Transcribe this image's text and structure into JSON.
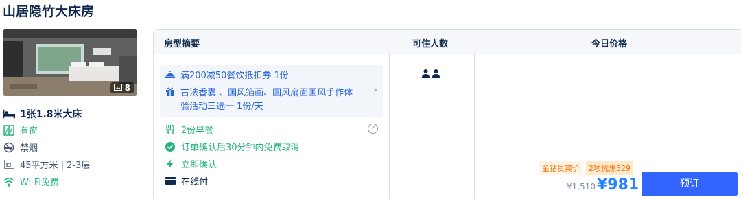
{
  "room": {
    "title": "山居隐竹大床房",
    "photo_count": "8"
  },
  "details": {
    "bed": "1张1.8米大床",
    "window": "有窗",
    "smoking": "禁烟",
    "area_floor": "45平方米 | 2-3层",
    "wifi": "Wi-Fi免费"
  },
  "table": {
    "headers": [
      "房型摘要",
      "可住人数",
      "今日价格"
    ]
  },
  "promo": {
    "coupon": "满200减50餐饮抵扣券 1份",
    "gift_line1": "古法香囊 、国风箔画、国风扇面国风手作体",
    "gift_line2": "验活动三选一 1份/天"
  },
  "features": {
    "breakfast": "2份早餐",
    "cancel": "订单确认后30分钟内免费取消",
    "confirm": "立即确认",
    "payment": "在线付"
  },
  "help_icon": "?",
  "arrow": "›",
  "pricing": {
    "member_label": "金钻贵宾价",
    "discount_label": "2项优惠529",
    "original": "¥1,510",
    "current": "¥981",
    "book": "预订"
  },
  "colors": {
    "accent_blue": "#3264ff",
    "price_blue": "#2681ff",
    "green": "#24b47e",
    "orange": "#ff6f00"
  }
}
